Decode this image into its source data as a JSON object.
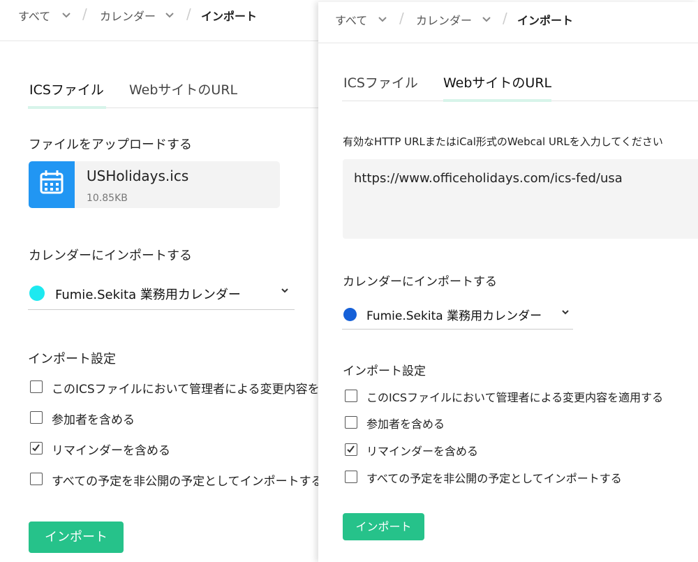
{
  "left_panel": {
    "breadcrumb": {
      "all": "すべて",
      "calendar": "カレンダー",
      "current": "インポート"
    },
    "tabs": {
      "ics": "ICSファイル",
      "url": "WebサイトのURL"
    },
    "upload_heading": "ファイルをアップロードする",
    "file": {
      "name": "USHolidays.ics",
      "size": "10.85KB"
    },
    "import_to_heading": "カレンダーにインポートする",
    "calendar": {
      "name": "Fumie.Sekita 業務用カレンダー",
      "color": "#1de9f0"
    },
    "settings_heading": "インポート設定",
    "options": [
      {
        "label": "このICSファイルにおいて管理者による変更内容を適用する",
        "checked": false
      },
      {
        "label": "参加者を含める",
        "checked": false
      },
      {
        "label": "リマインダーを含める",
        "checked": true
      },
      {
        "label": "すべての予定を非公開の予定としてインポートする",
        "checked": false
      }
    ],
    "import_button": "インポート"
  },
  "right_panel": {
    "breadcrumb": {
      "all": "すべて",
      "calendar": "カレンダー",
      "current": "インポート"
    },
    "tabs": {
      "ics": "ICSファイル",
      "url": "WebサイトのURL"
    },
    "url_hint": "有効なHTTP URLまたはiCal形式のWebcal URLを入力してください",
    "url_value": "https://www.officeholidays.com/ics-fed/usa",
    "import_to_heading": "カレンダーにインポートする",
    "calendar": {
      "name": "Fumie.Sekita 業務用カレンダー",
      "color": "#1560d8"
    },
    "settings_heading": "インポート設定",
    "options": [
      {
        "label": "このICSファイルにおいて管理者による変更内容を適用する",
        "checked": false
      },
      {
        "label": "参加者を含める",
        "checked": false
      },
      {
        "label": "リマインダーを含める",
        "checked": true
      },
      {
        "label": "すべての予定を非公開の予定としてインポートする",
        "checked": false
      }
    ],
    "import_button": "インポート"
  },
  "accent_color": "#26c28a"
}
